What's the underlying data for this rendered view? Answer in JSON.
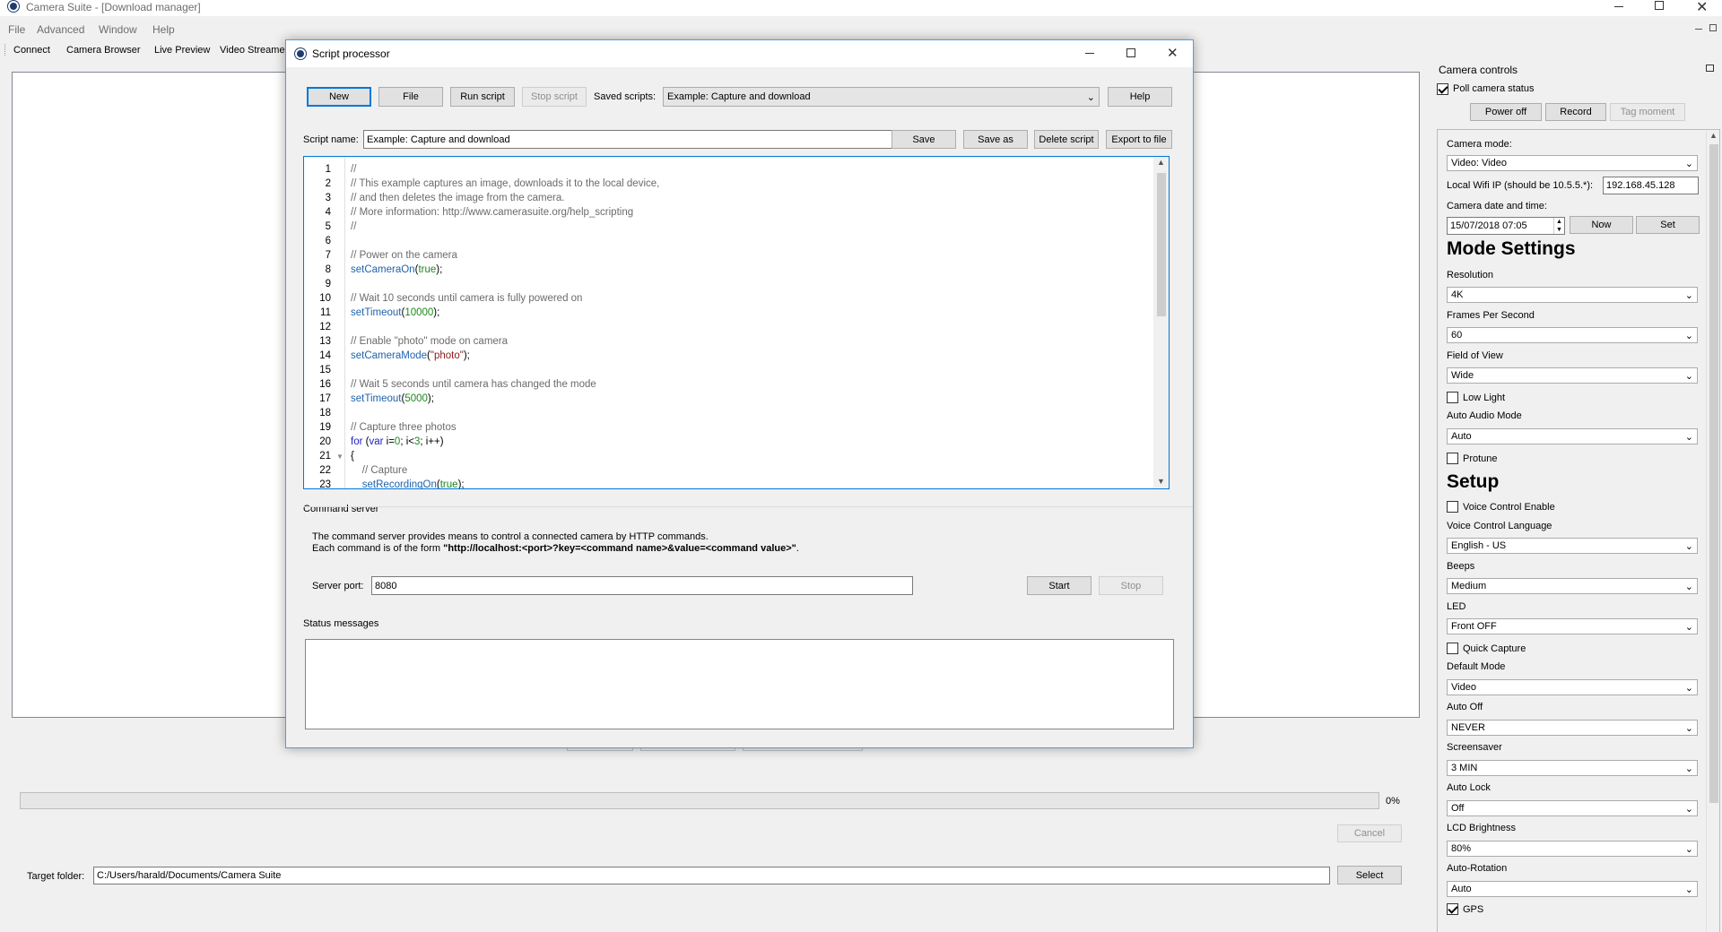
{
  "app": {
    "title": "Camera Suite - [Download manager]",
    "menu": [
      "File",
      "Advanced",
      "Window",
      "Help"
    ],
    "toolbar": [
      "Connect",
      "Camera Browser",
      "Live Preview",
      "Video Streamer"
    ]
  },
  "bottom": {
    "progress_percent": 0,
    "progress_label": "0%",
    "cancel_label": "Cancel",
    "target_folder_label": "Target folder:",
    "target_folder_value": "C:/Users/harald/Documents/Camera Suite",
    "select_label": "Select"
  },
  "dialog": {
    "title": "Script processor",
    "buttons": {
      "new": "New",
      "file": "File",
      "run": "Run script",
      "stop": "Stop script",
      "help": "Help"
    },
    "saved_scripts_label": "Saved scripts:",
    "saved_scripts_value": "Example: Capture and download",
    "script_name_label": "Script name:",
    "script_name_value": "Example: Capture and download",
    "save": "Save",
    "save_as": "Save as",
    "delete_script": "Delete script",
    "export_to_file": "Export to file",
    "code_lines": [
      "//",
      "// This example captures an image, downloads it to the local device,",
      "// and then deletes the image from the camera.",
      "// More information: http://www.camerasuite.org/help_scripting",
      "//",
      "",
      "// Power on the camera",
      "setCameraOn(true);",
      "",
      "// Wait 10 seconds until camera is fully powered on",
      "setTimeout(10000);",
      "",
      "// Enable \"photo\" mode on camera",
      "setCameraMode(\"photo\");",
      "",
      "// Wait 5 seconds until camera has changed the mode",
      "setTimeout(5000);",
      "",
      "// Capture three photos",
      "for (var i=0; i<3; i++)",
      "{",
      "    // Capture",
      "    setRecordingOn(true);"
    ],
    "command_server": {
      "title": "Command server",
      "desc1": "The command server provides means to control a connected camera by HTTP commands.",
      "desc2_prefix": "Each command is of the form ",
      "desc2_bold": "\"http://localhost:<port>?key=<command name>&value=<command value>\"",
      "desc2_suffix": ".",
      "port_label": "Server port:",
      "port_value": "8080",
      "start": "Start",
      "stop": "Stop"
    },
    "status_title": "Status messages"
  },
  "camera_controls": {
    "title": "Camera controls",
    "poll_label": "Poll camera status",
    "poll_checked": true,
    "power_off": "Power off",
    "record": "Record",
    "tag_moment": "Tag moment",
    "camera_mode_label": "Camera mode:",
    "camera_mode_value": "Video: Video",
    "wifi_label": "Local Wifi IP (should be 10.5.5.*):",
    "wifi_value": "192.168.45.128",
    "datetime_label": "Camera date and time:",
    "datetime_value": "15/07/2018 07:05",
    "now": "Now",
    "set": "Set",
    "mode_settings_heading": "Mode Settings",
    "resolution_label": "Resolution",
    "resolution_value": "4K",
    "fps_label": "Frames Per Second",
    "fps_value": "60",
    "fov_label": "Field of View",
    "fov_value": "Wide",
    "low_light": "Low Light",
    "auto_audio_label": "Auto Audio Mode",
    "auto_audio_value": "Auto",
    "protune": "Protune",
    "setup_heading": "Setup",
    "voice_control": "Voice Control Enable",
    "voice_lang_label": "Voice Control Language",
    "voice_lang_value": "English - US",
    "beeps_label": "Beeps",
    "beeps_value": "Medium",
    "led_label": "LED",
    "led_value": "Front OFF",
    "quick_capture": "Quick Capture",
    "default_mode_label": "Default Mode",
    "default_mode_value": "Video",
    "auto_off_label": "Auto Off",
    "auto_off_value": "NEVER",
    "screensaver_label": "Screensaver",
    "screensaver_value": "3 MIN",
    "auto_lock_label": "Auto Lock",
    "auto_lock_value": "Off",
    "lcd_label": "LCD Brightness",
    "lcd_value": "80%",
    "auto_rotation_label": "Auto-Rotation",
    "auto_rotation_value": "Auto",
    "gps_label": "GPS"
  },
  "colors": {
    "accent": "#0078d7",
    "dialog_border": "#5a9bd5"
  }
}
